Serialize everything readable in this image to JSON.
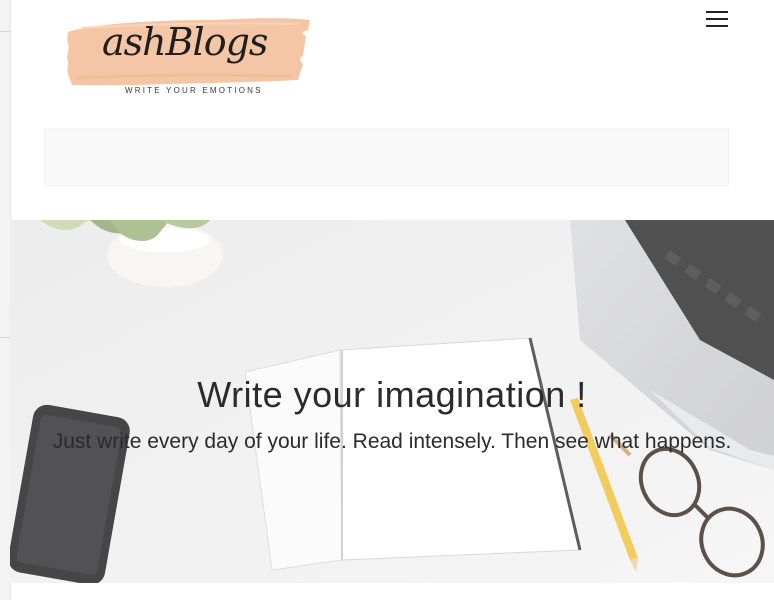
{
  "header": {
    "logo": {
      "name": "ashBlogs",
      "tagline": "WRITE YOUR EMOTIONS",
      "brush_color": "#f5c6a6"
    },
    "menu_toggle_icon": "hamburger-menu-icon"
  },
  "hero": {
    "title": "Write your imagination !",
    "subtitle": "Just write every day of your life. Read intensely. Then see what happens."
  }
}
